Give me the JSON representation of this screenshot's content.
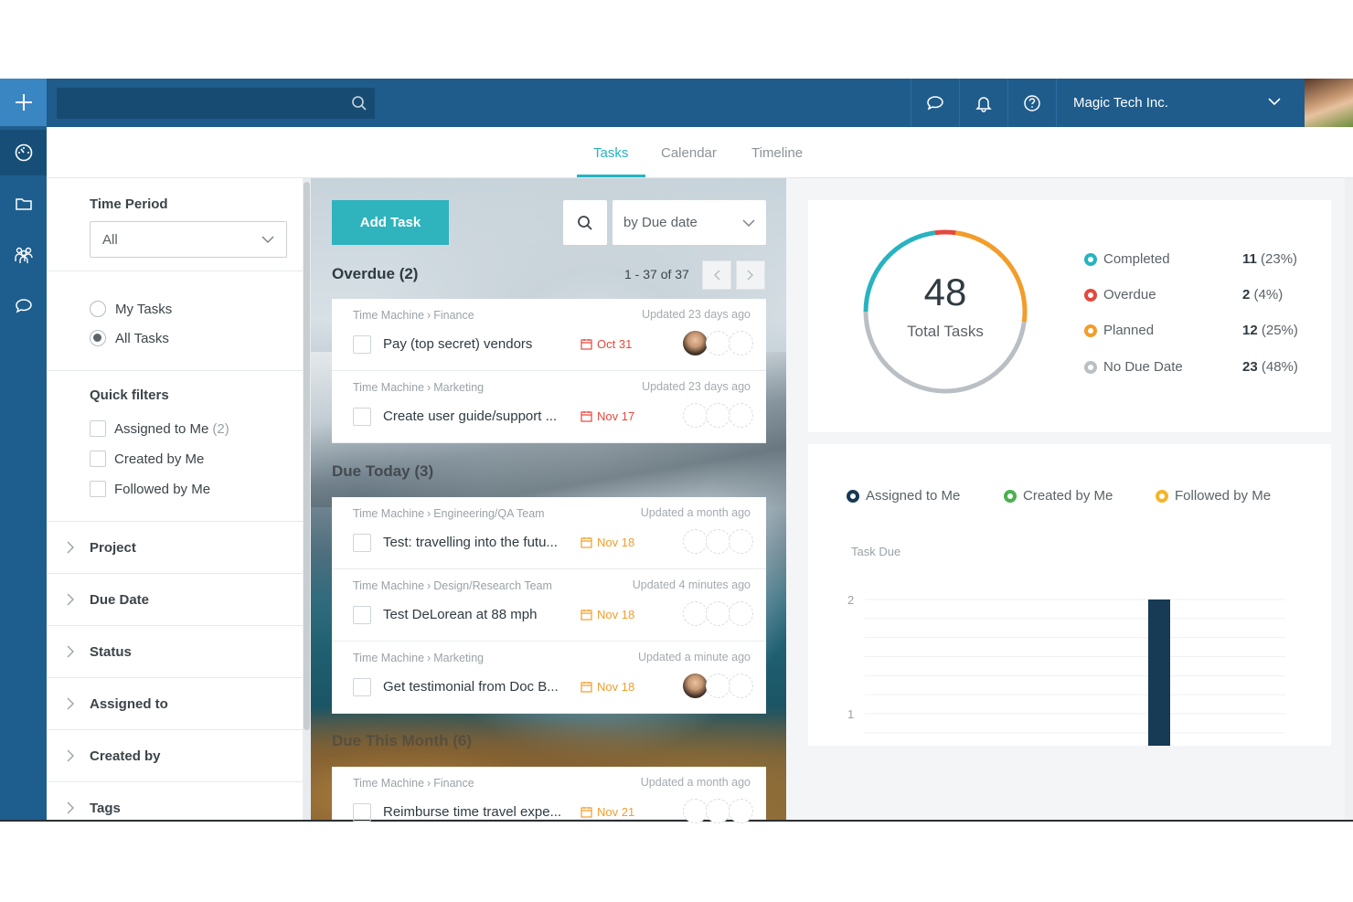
{
  "topbar": {
    "search_placeholder": "",
    "workspace": "Magic Tech Inc."
  },
  "tabs": [
    {
      "label": "Tasks",
      "active": true
    },
    {
      "label": "Calendar",
      "active": false
    },
    {
      "label": "Timeline",
      "active": false
    }
  ],
  "filters": {
    "time_period_title": "Time Period",
    "time_period_value": "All",
    "scope": [
      {
        "label": "My Tasks",
        "selected": false
      },
      {
        "label": "All Tasks",
        "selected": true
      }
    ],
    "quick_filters_title": "Quick filters",
    "quick": [
      {
        "label": "Assigned to Me",
        "count": "(2)"
      },
      {
        "label": "Created by Me",
        "count": ""
      },
      {
        "label": "Followed by Me",
        "count": ""
      }
    ],
    "accordions": [
      "Project",
      "Due Date",
      "Status",
      "Assigned to",
      "Created by",
      "Tags"
    ]
  },
  "tasks": {
    "add_label": "Add Task",
    "sort_label": "by Due date",
    "pager": "1 - 37 of 37",
    "groups": [
      {
        "title": "Overdue (2)"
      },
      {
        "title": "Due Today (3)"
      },
      {
        "title": "Due This Month (6)"
      }
    ],
    "cards": [
      {
        "project": "Time Machine",
        "section": "Finance",
        "updated": "Updated 23 days ago",
        "name": "Pay (top secret) vendors",
        "due": "Oct 31",
        "due_color": "#e5483c",
        "assignee": true
      },
      {
        "project": "Time Machine",
        "section": "Marketing",
        "updated": "Updated 23 days ago",
        "name": "Create user guide/support ...",
        "due": "Nov 17",
        "due_color": "#e5483c",
        "assignee": false
      },
      {
        "project": "Time Machine",
        "section": "Engineering/QA Team",
        "updated": "Updated a month ago",
        "name": "Test: travelling into the futu...",
        "due": "Nov 18",
        "due_color": "#f29d2b",
        "assignee": false
      },
      {
        "project": "Time Machine",
        "section": "Design/Research Team",
        "updated": "Updated 4 minutes ago",
        "name": "Test DeLorean at 88 mph",
        "due": "Nov 18",
        "due_color": "#f29d2b",
        "assignee": false
      },
      {
        "project": "Time Machine",
        "section": "Marketing",
        "updated": "Updated a minute ago",
        "name": "Get testimonial from Doc B...",
        "due": "Nov 18",
        "due_color": "#f29d2b",
        "assignee": true
      },
      {
        "project": "Time Machine",
        "section": "Finance",
        "updated": "Updated a month ago",
        "name": "Reimburse time travel expe...",
        "due": "Nov 21",
        "due_color": "#f29d2b",
        "assignee": false
      }
    ]
  },
  "stats": {
    "total": "48",
    "total_label": "Total Tasks",
    "legend": [
      {
        "label": "Completed",
        "count": "11",
        "pct": "(23%)",
        "color": "#27b3c0"
      },
      {
        "label": "Overdue",
        "count": "2",
        "pct": "(4%)",
        "color": "#e5483c"
      },
      {
        "label": "Planned",
        "count": "12",
        "pct": "(25%)",
        "color": "#f29d2b"
      },
      {
        "label": "No Due Date",
        "count": "23",
        "pct": "(48%)",
        "color": "#b9bfc4"
      }
    ]
  },
  "chart_data": {
    "type": "bar",
    "series_legend": [
      {
        "name": "Assigned to Me",
        "color": "#173a55"
      },
      {
        "name": "Created by Me",
        "color": "#4cb050"
      },
      {
        "name": "Followed by Me",
        "color": "#f3b52a"
      }
    ],
    "title": "Task Due",
    "yticks": [
      "2",
      "1"
    ],
    "ylim": [
      0,
      2
    ],
    "bars": [
      {
        "x_fraction": 0.7,
        "value": 2,
        "series": "Assigned to Me"
      }
    ]
  }
}
